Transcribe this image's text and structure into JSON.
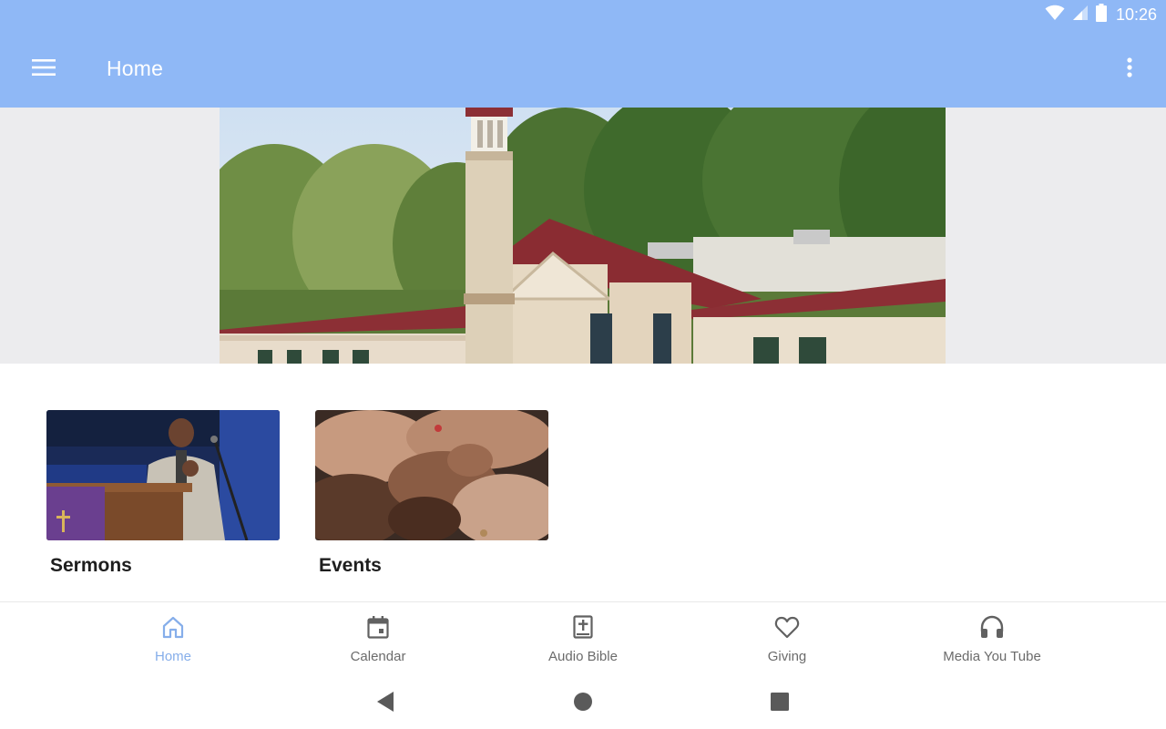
{
  "status_bar": {
    "time": "10:26",
    "icons": [
      "wifi-icon",
      "cell-signal-icon",
      "battery-icon"
    ]
  },
  "app_bar": {
    "title": "Home",
    "menu_icon": "hamburger-menu-icon",
    "more_icon": "more-vert-icon",
    "color": "#8fb8f6"
  },
  "hero": {
    "image": "church-building-photo"
  },
  "cards": [
    {
      "label": "Sermons",
      "image": "preacher-at-pulpit-photo"
    },
    {
      "label": "Events",
      "image": "joined-hands-photo"
    }
  ],
  "bottom_nav": {
    "items": [
      {
        "label": "Home",
        "icon": "home-icon",
        "active": true
      },
      {
        "label": "Calendar",
        "icon": "calendar-icon",
        "active": false
      },
      {
        "label": "Audio Bible",
        "icon": "bible-icon",
        "active": false
      },
      {
        "label": "Giving",
        "icon": "heart-icon",
        "active": false
      },
      {
        "label": "Media You Tube",
        "icon": "headphones-icon",
        "active": false
      }
    ],
    "active_color": "#86aeea",
    "inactive_color": "#6b6b6b"
  },
  "system_nav": {
    "buttons": [
      "back-triangle-icon",
      "home-circle-icon",
      "recents-square-icon"
    ]
  }
}
